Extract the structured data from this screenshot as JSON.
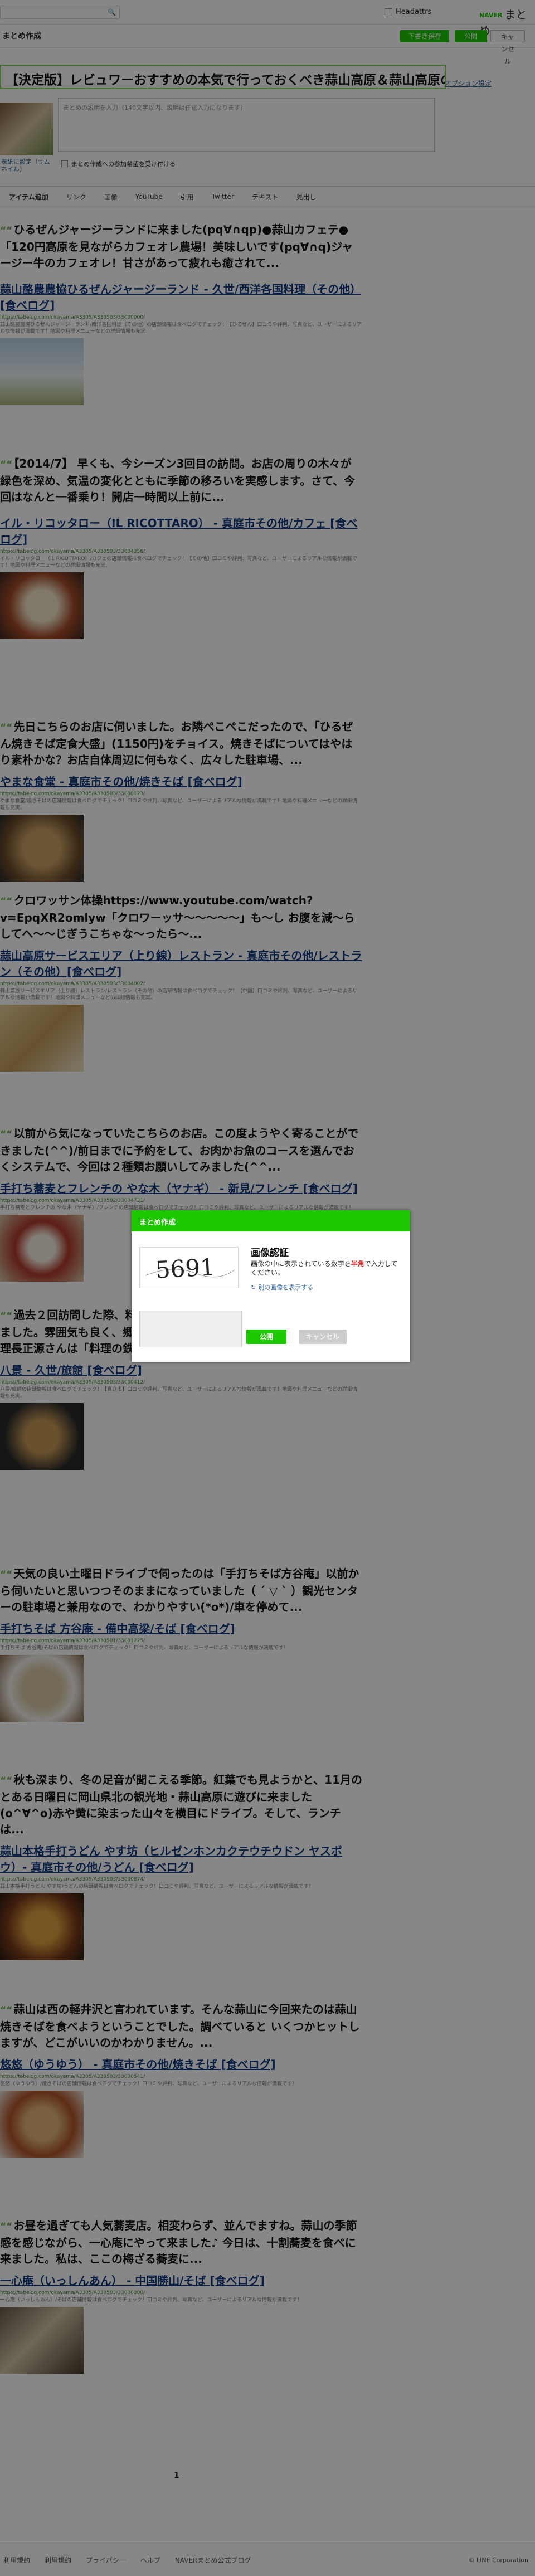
{
  "header": {
    "search_placeholder": "",
    "check_label": "Headattrs",
    "naver_label": "NAVER",
    "logo_text": "まとめ"
  },
  "subbar": {
    "title": "まとめ作成",
    "draft_label": "下書き保存",
    "publish_label": "公開",
    "cancel_label": "キャンセル"
  },
  "editor": {
    "title": "【決定版】レビュワーおすすめの本気で行っておくべき蒜山高原＆蒜山高原の",
    "option_link": "オプション設定",
    "thumb_change_link": "表紙に設定（サムネイル）",
    "desc_placeholder": "まとめの説明を入力（140文字以内、説明は任意入力になります）",
    "check_label": "まとめ作成への参加希望を受け付ける"
  },
  "tabs": [
    "アイテム追加",
    "リンク",
    "画像",
    "YouTube",
    "引用",
    "Twitter",
    "テキスト",
    "見出し"
  ],
  "items": [
    {
      "quote": "ひるぜんジャージーランドに来ました(pq∀∩qp)●蒜山カフェテ●「120円高原を見ながらカフェオレ農場！美味しいです(pq∀∩q)ジャージー牛のカフェオレ！甘さがあって疲れも癒されて...",
      "link_title": "蒜山酪農農協ひるぜんジャージーランド - 久世/西洋各国料理（その他）[食べログ]",
      "url": "https://tabelog.com/okayama/A3305/A330503/33000000/",
      "desc": "蒜山酪農農協ひるぜんジャージーランド/西洋各国料理（その他）の店舗情報は食べログでチェック！【ひるぜん】口コミや評判、写真など、ユーザーによるリアルな情報が満載です！地図や料理メニューなどの詳細情報も充実。"
    },
    {
      "quote": "【2014/7】 早くも、今シーズン3回目の訪問。お店の周りの木々が緑色を深め、気温の変化とともに季節の移ろいを実感します。さて、今回はなんと一番乗り！開店一時間以上前に...",
      "link_title": "イル・リコッタロー（IL RICOTTARO） - 真庭市その他/カフェ [食べログ]",
      "url": "https://tabelog.com/okayama/A3305/A330503/33004356/",
      "desc": "イル・リコッタロー（IL RICOTTARO）/カフェの店舗情報は食べログでチェック！【その他】口コミや評判、写真など、ユーザーによるリアルな情報が満載です！地図や料理メニューなどの詳細情報も充実。"
    },
    {
      "quote": "先日こちらのお店に伺いました。お隣ぺこぺこだったので、「ひるぜん焼きそば定食大盛」(1150円)をチョイス。焼きそばについてはやはり素朴かな？お店自体周辺に何もなく、広々した駐車場、...",
      "link_title": "やまな食堂 - 真庭市その他/焼きそば [食べログ]",
      "url": "https://tabelog.com/okayama/A3305/A330503/33000123/",
      "desc": "やまな食堂/焼きそばの店舗情報は食べログでチェック！口コミや評判、写真など、ユーザーによるリアルな情報が満載です！地図や料理メニューなどの詳細情報も充実。"
    },
    {
      "quote": "クロワッサン体操https://www.youtube.com/watch?v=EpqXR2omlyw「クロワーッサ〜〜〜〜〜」も〜し お腹を減〜らしてへ〜〜じぎうこちゃな〜ったら〜...",
      "link_title": "蒜山高原サービスエリア（上り線）レストラン - 真庭市その他/レストラン（その他）[食べログ]",
      "url": "https://tabelog.com/okayama/A3305/A330503/33004002/",
      "desc": "蒜山高原サービスエリア（上り線）レストラン/レストラン（その他）の店舗情報は食べログでチェック！【中国】口コミや評判、写真など、ユーザーによるリアルな情報が満載です！地図や料理メニューなどの詳細情報も充実。"
    },
    {
      "quote": "以前から気になっていたこちらのお店。この度ようやく寄ることができました(^^)/前日までに予約をして、お肉かお魚のコースを選んでおくシステムで、今回は２種類お願いしてみました(^^...",
      "link_title": "手打ち蕎麦とフレンチの やな木（ヤナギ） - 新見/フレンチ [食べログ]",
      "url": "https://tabelog.com/okayama/A3305/A330502/33004731/",
      "desc": "手打ち蕎麦とフレンチの やな木（ヤナギ）/フレンチの店舗情報は食べログでチェック！口コミや評判、写真など、ユーザーによるリアルな情報が満載です！"
    },
    {
      "quote": "過去２回訪問した際、料理に感激したことから、三度目の訪問となりました。雰囲気も良く、郷土料理の見どころ「花ぐるま」へ。ここの料理長正源さんは「料理の鉄人」に出演...",
      "link_title": "",
      "url": "",
      "desc": ""
    },
    {
      "quote": "",
      "link_title": "八景 - 久世/旅館 [食べログ]",
      "url": "https://tabelog.com/okayama/A3305/A330503/33000412/",
      "desc": "八景/旅館の店舗情報は食べログでチェック！【真庭市】口コミや評判、写真など、ユーザーによるリアルな情報が満載です！地図や料理メニューなどの詳細情報も充実。"
    },
    {
      "quote": "天気の良い土曜日ドライブで伺ったのは「手打ちそば方谷庵」以前から伺いたいと思いつつそのままになっていました（ ´ ▽ ` ）観光センターの駐車場と兼用なので、わかりやすい(*o*)/車を停めて...",
      "link_title": "手打ちそば 方谷庵 - 備中高梁/そば [食べログ]",
      "url": "https://tabelog.com/okayama/A3305/A330501/33001225/",
      "desc": "手打ちそば 方谷庵/そばの店舗情報は食べログでチェック！口コミや評判、写真など、ユーザーによるリアルな情報が満載です！"
    },
    {
      "quote": "秋も深まり、冬の足音が聞こえる季節。紅葉でも見ようかと、11月のとある日曜日に岡山県北の観光地・蒜山高原に遊びに来ました(o^∀^o)赤や黄に染まった山々を横目にドライブ。そして、ランチは...",
      "link_title": "蒜山本格手打うどん やす坊（ヒルゼンホンカクテウチウドン ヤスボウ）- 真庭市その他/うどん [食べログ]",
      "url": "https://tabelog.com/okayama/A3305/A330503/33000874/",
      "desc": "蒜山本格手打うどん やす坊/うどんの店舗情報は食べログでチェック！口コミや評判、写真など、ユーザーによるリアルな情報が満載です！"
    },
    {
      "quote": "蒜山は西の軽井沢と言われています。そんな蒜山に今回来たのは蒜山焼きそばを食べようということでした。調べていると いくつかヒットしますが、どこがいいのかわかりません。...",
      "link_title": "悠悠（ゆうゆう） - 真庭市その他/焼きそば [食べログ]",
      "url": "https://tabelog.com/okayama/A3305/A330503/33000541/",
      "desc": "悠悠（ゆうゆう）/焼きそばの店舗情報は食べログでチェック！口コミや評判、写真など、ユーザーによるリアルな情報が満載です！"
    },
    {
      "quote": "お昼を過ぎても人気蕎麦店。相変わらず、並んでますね。蒜山の季節感を感じながら、一心庵にやって来ました♪ 今日は、十割蕎麦を食べに来ました。私は、ここの梅ざる蕎麦に...",
      "link_title": "一心庵（いっしんあん） - 中国勝山/そば [食べログ]",
      "url": "https://tabelog.com/okayama/A3305/A330503/33000300/",
      "desc": "一心庵（いっしんあん）/そばの店舗情報は食べログでチェック！口コミや評判、写真など、ユーザーによるリアルな情報が満載です！"
    }
  ],
  "pagination": {
    "current": "1"
  },
  "footer": {
    "links": [
      "利用規約",
      "利用規約",
      "プライバシー",
      "ヘルプ",
      "NAVERまとめ公式ブログ"
    ],
    "copyright": "© LINE Corporation"
  },
  "modal": {
    "header": "まとめ作成",
    "captcha_text": "5691",
    "title": "画像認証",
    "text_before": "画像の中に表示されている数字を",
    "text_highlight": "半角",
    "text_after": "で入力してください。",
    "reload_label": "別の画像を表示する",
    "ok_label": "公開",
    "cancel_label": "キャンセル"
  },
  "colors": {
    "accent": "#1ec800",
    "link": "#123a7e",
    "overlay": "rgba(0,0,0,0.47)"
  }
}
